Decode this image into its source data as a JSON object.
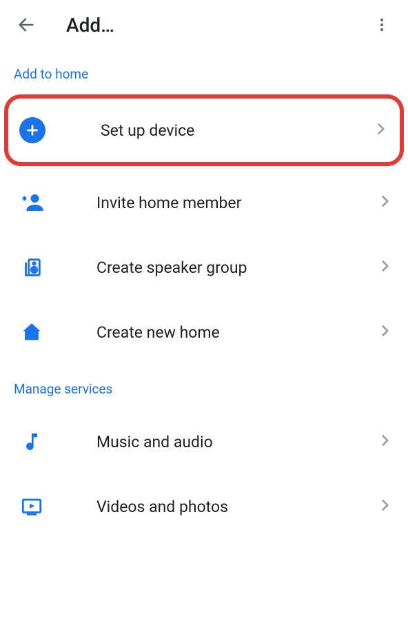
{
  "header": {
    "title": "Add…"
  },
  "sections": {
    "add_to_home": {
      "title": "Add to home",
      "items": {
        "setup_device": {
          "label": "Set up device"
        },
        "invite_member": {
          "label": "Invite home member"
        },
        "speaker_group": {
          "label": "Create speaker group"
        },
        "new_home": {
          "label": "Create new home"
        }
      }
    },
    "manage_services": {
      "title": "Manage services",
      "items": {
        "music": {
          "label": "Music and audio"
        },
        "videos": {
          "label": "Videos and photos"
        }
      }
    }
  }
}
